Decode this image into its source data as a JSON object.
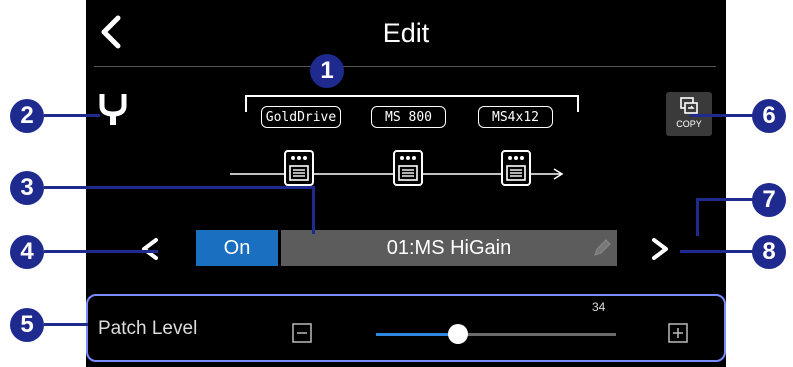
{
  "header": {
    "title": "Edit"
  },
  "chain": {
    "effects": [
      {
        "name": "GoldDrive"
      },
      {
        "name": "MS 800"
      },
      {
        "name": "MS4x12"
      }
    ]
  },
  "copy_button": {
    "label": "COPY"
  },
  "patch": {
    "on_label": "On",
    "name": "01:MS HiGain"
  },
  "patch_level": {
    "label": "Patch Level",
    "value": "34",
    "fraction": 0.34
  },
  "callouts": [
    "1",
    "2",
    "3",
    "4",
    "5",
    "6",
    "7",
    "8"
  ],
  "colors": {
    "accent": "#1a6fc0",
    "callout": "#1f2a8e",
    "panel_border": "#7a8cff"
  }
}
